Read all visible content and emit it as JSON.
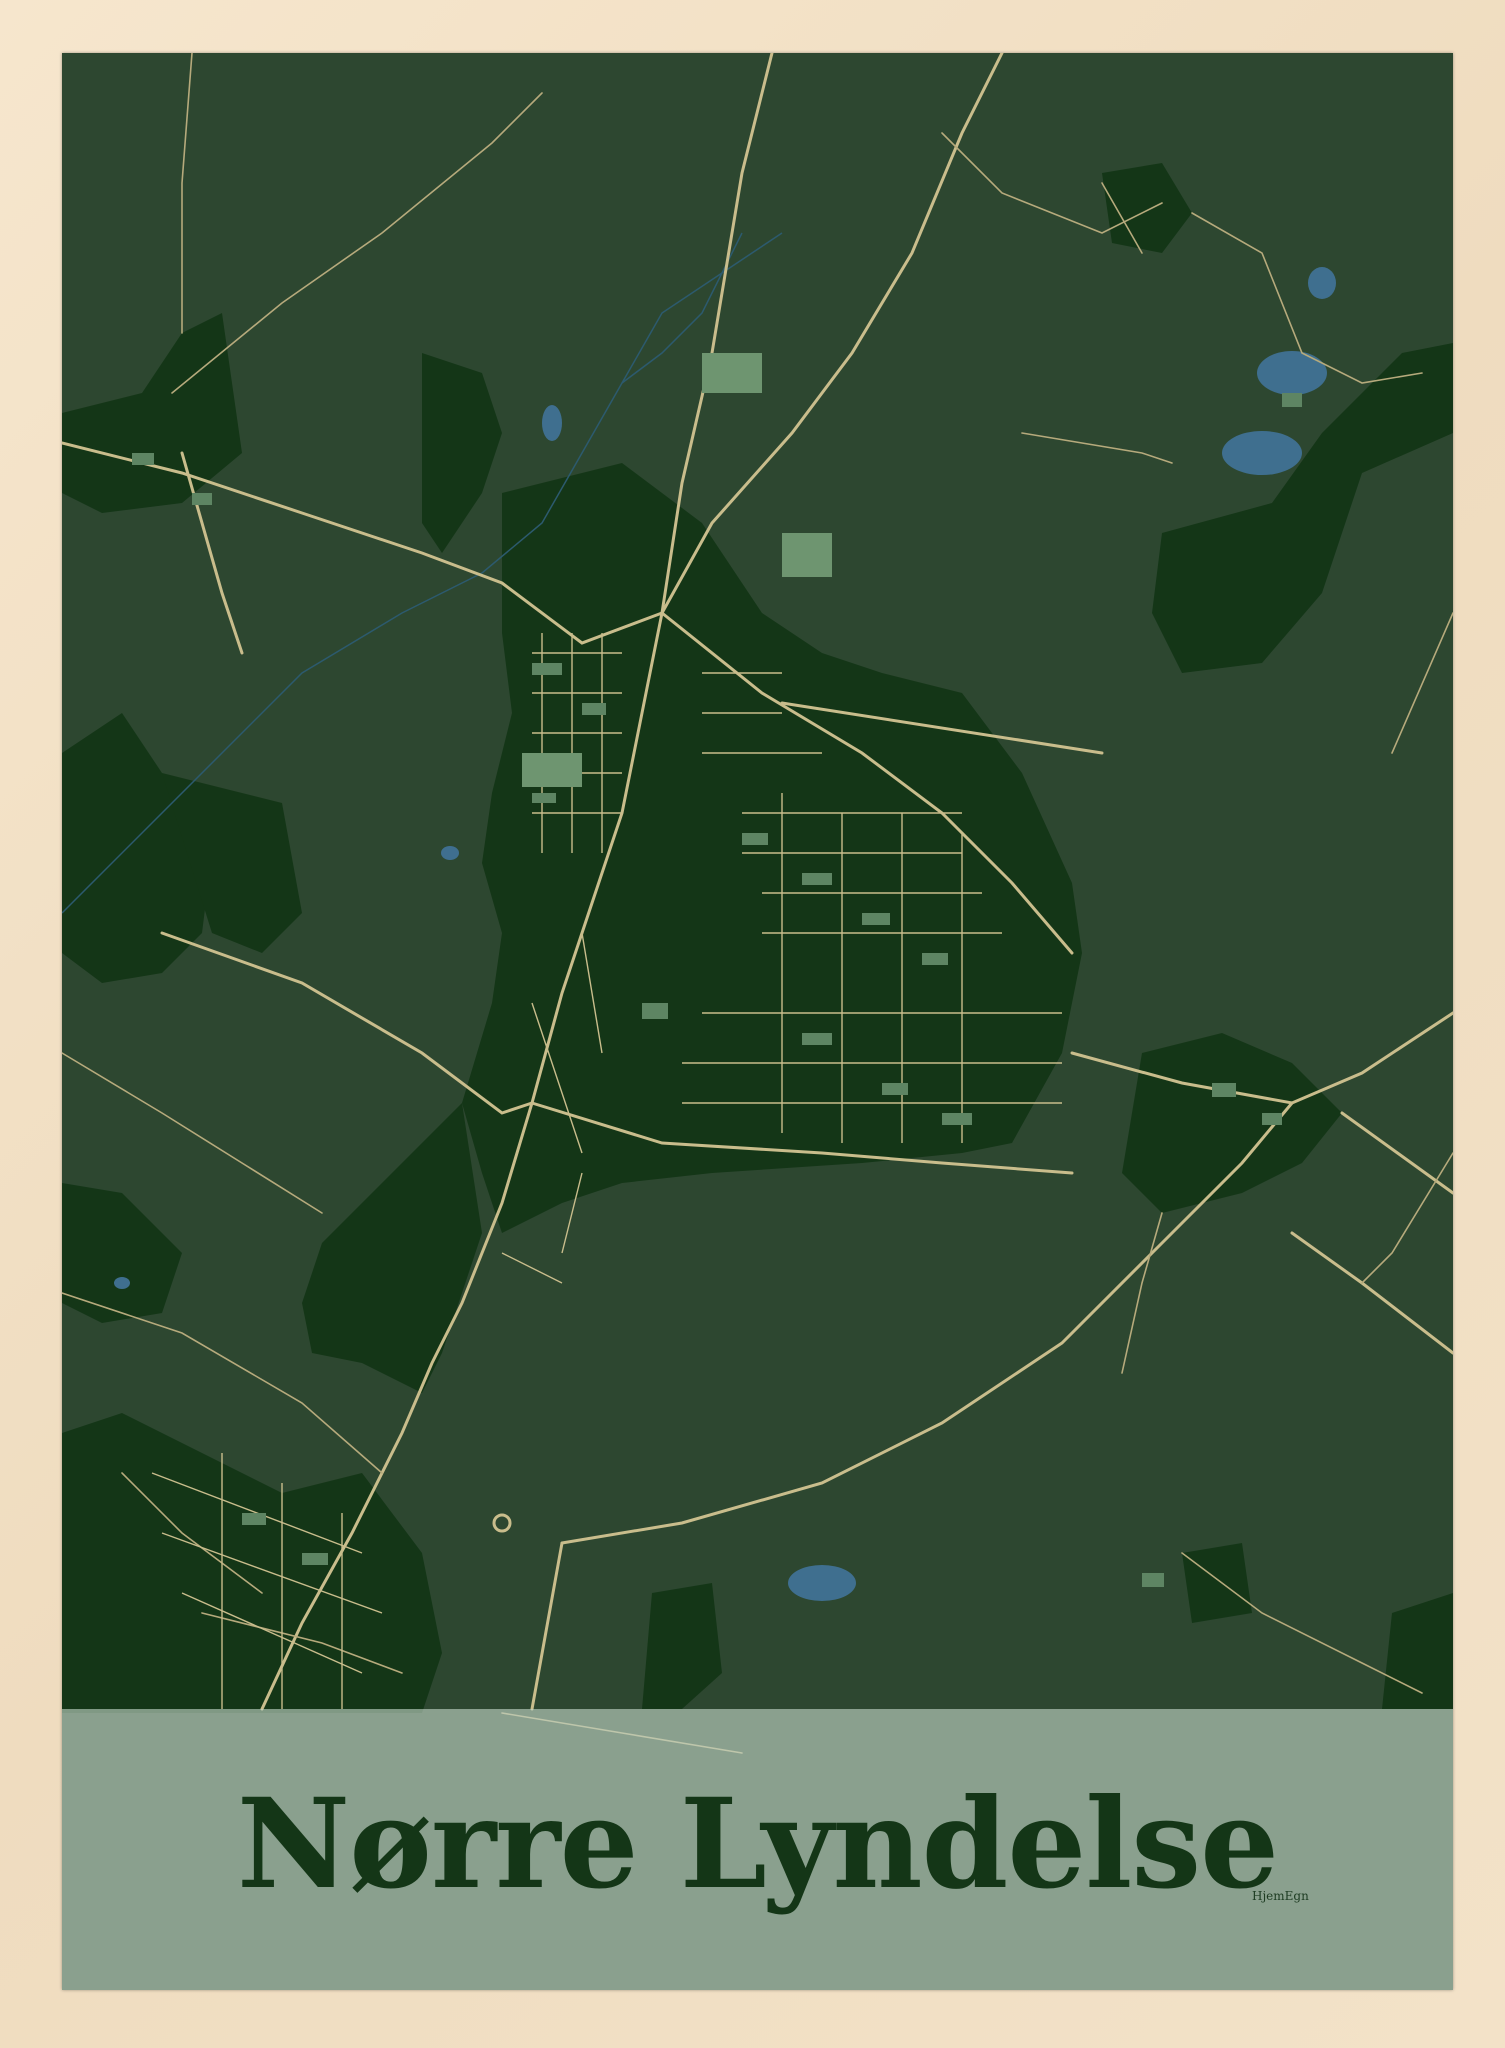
{
  "poster": {
    "place_name": "Nørre Lyndelse",
    "brand": "HjemEgn"
  },
  "colors": {
    "frame": "#f1dfc4",
    "land": "#2d4730",
    "built_area": "#143617",
    "roads": "#c9bd8c",
    "water": "#3f6f8f",
    "buildings": "#5e8563",
    "title_band": "#c4d6c8",
    "title_text": "#143617"
  }
}
